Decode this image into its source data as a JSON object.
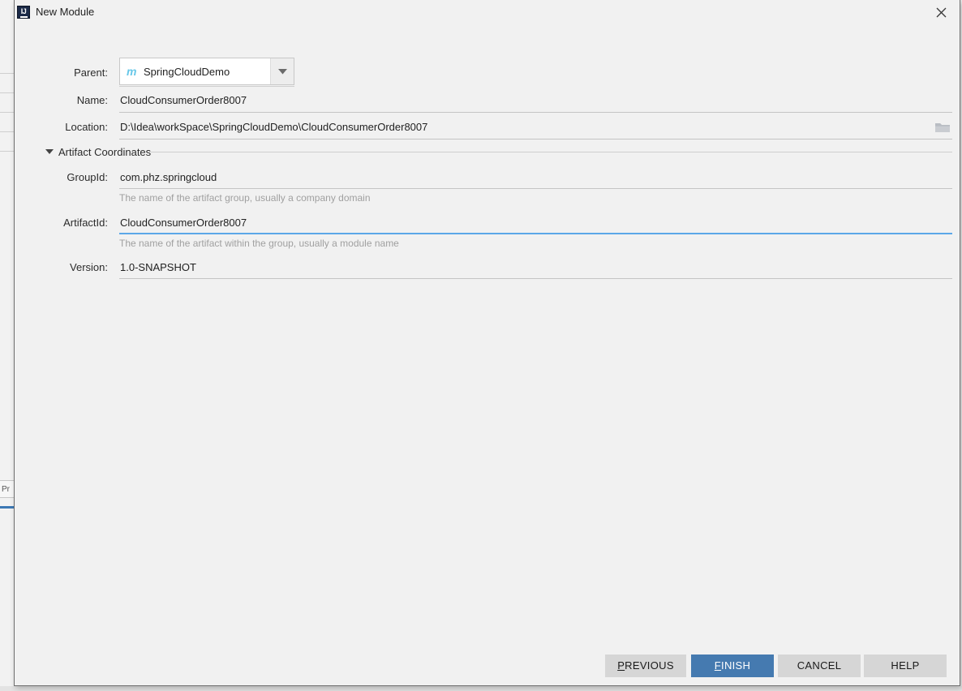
{
  "window": {
    "title": "New Module",
    "app_icon": "intellij-idea-icon",
    "close_icon": "close-icon"
  },
  "backdrop": {
    "tab_label": "Pr"
  },
  "form": {
    "parent": {
      "label": "Parent:",
      "value": "SpringCloudDemo",
      "icon": "maven-module-icon",
      "icon_glyph": "m",
      "arrow_icon": "chevron-down-icon"
    },
    "name": {
      "label": "Name:",
      "value": "CloudConsumerOrder8007"
    },
    "location": {
      "label": "Location:",
      "value": "D:\\Idea\\workSpace\\SpringCloudDemo\\CloudConsumerOrder8007",
      "browse_icon": "folder-icon"
    }
  },
  "section": {
    "title": "Artifact Coordinates",
    "toggle_icon": "triangle-down-icon",
    "expanded": true,
    "fields": {
      "group_id": {
        "label": "GroupId:",
        "value": "com.phz.springcloud",
        "hint": "The name of the artifact group, usually a company domain",
        "focused": false
      },
      "artifact_id": {
        "label": "ArtifactId:",
        "value": "CloudConsumerOrder8007",
        "hint": "The name of the artifact within the group, usually a module name",
        "focused": true
      },
      "version": {
        "label": "Version:",
        "value": "1.0-SNAPSHOT",
        "hint": "",
        "focused": false
      }
    }
  },
  "buttons": {
    "previous": {
      "prefix": "",
      "mnemonic": "P",
      "suffix": "REVIOUS"
    },
    "finish": {
      "prefix": "",
      "mnemonic": "F",
      "suffix": "INISH"
    },
    "cancel": {
      "label": "CANCEL"
    },
    "help": {
      "label": "HELP"
    }
  },
  "colors": {
    "dialog_background": "#f1f1f1",
    "primary_button": "#457ab0",
    "focus_underline": "#5ba7e8",
    "field_underline": "#c4c4c4",
    "hint_text": "#a0a0a0",
    "maven_icon": "#67c7e8"
  }
}
